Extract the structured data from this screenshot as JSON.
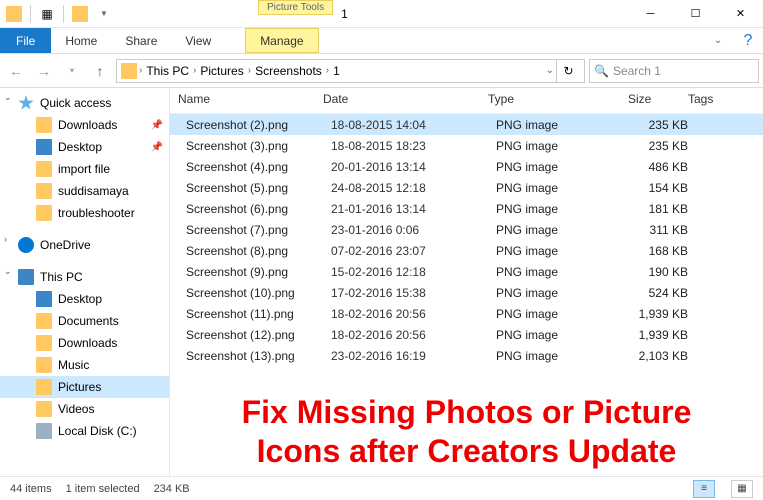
{
  "titlebar": {
    "context_label": "Picture Tools",
    "title": "1"
  },
  "ribbon": {
    "file": "File",
    "tabs": [
      "Home",
      "Share",
      "View"
    ],
    "context_tab": "Manage"
  },
  "breadcrumb": {
    "items": [
      "This PC",
      "Pictures",
      "Screenshots",
      "1"
    ]
  },
  "search": {
    "placeholder": "Search 1"
  },
  "sidebar": {
    "quick_access": "Quick access",
    "qa_items": [
      "Downloads",
      "Desktop",
      "import file",
      "suddisamaya",
      "troubleshooter"
    ],
    "onedrive": "OneDrive",
    "this_pc": "This PC",
    "pc_items": [
      "Desktop",
      "Documents",
      "Downloads",
      "Music",
      "Pictures",
      "Videos",
      "Local Disk (C:)"
    ]
  },
  "columns": {
    "name": "Name",
    "date": "Date",
    "type": "Type",
    "size": "Size",
    "tags": "Tags"
  },
  "files": [
    {
      "name": "Screenshot (2).png",
      "date": "18-08-2015 14:04",
      "type": "PNG image",
      "size": "235 KB",
      "selected": true
    },
    {
      "name": "Screenshot (3).png",
      "date": "18-08-2015 18:23",
      "type": "PNG image",
      "size": "235 KB"
    },
    {
      "name": "Screenshot (4).png",
      "date": "20-01-2016 13:14",
      "type": "PNG image",
      "size": "486 KB"
    },
    {
      "name": "Screenshot (5).png",
      "date": "24-08-2015 12:18",
      "type": "PNG image",
      "size": "154 KB"
    },
    {
      "name": "Screenshot (6).png",
      "date": "21-01-2016 13:14",
      "type": "PNG image",
      "size": "181 KB"
    },
    {
      "name": "Screenshot (7).png",
      "date": "23-01-2016 0:06",
      "type": "PNG image",
      "size": "311 KB"
    },
    {
      "name": "Screenshot (8).png",
      "date": "07-02-2016 23:07",
      "type": "PNG image",
      "size": "168 KB"
    },
    {
      "name": "Screenshot (9).png",
      "date": "15-02-2016 12:18",
      "type": "PNG image",
      "size": "190 KB"
    },
    {
      "name": "Screenshot (10).png",
      "date": "17-02-2016 15:38",
      "type": "PNG image",
      "size": "524 KB"
    },
    {
      "name": "Screenshot (11).png",
      "date": "18-02-2016 20:56",
      "type": "PNG image",
      "size": "1,939 KB"
    },
    {
      "name": "Screenshot (12).png",
      "date": "18-02-2016 20:56",
      "type": "PNG image",
      "size": "1,939 KB"
    },
    {
      "name": "Screenshot (13).png",
      "date": "23-02-2016 16:19",
      "type": "PNG image",
      "size": "2,103 KB"
    }
  ],
  "overlay": {
    "line1": "Fix Missing Photos or Picture",
    "line2": "Icons after Creators Update"
  },
  "status": {
    "count": "44 items",
    "selection": "1 item selected",
    "sel_size": "234 KB"
  }
}
